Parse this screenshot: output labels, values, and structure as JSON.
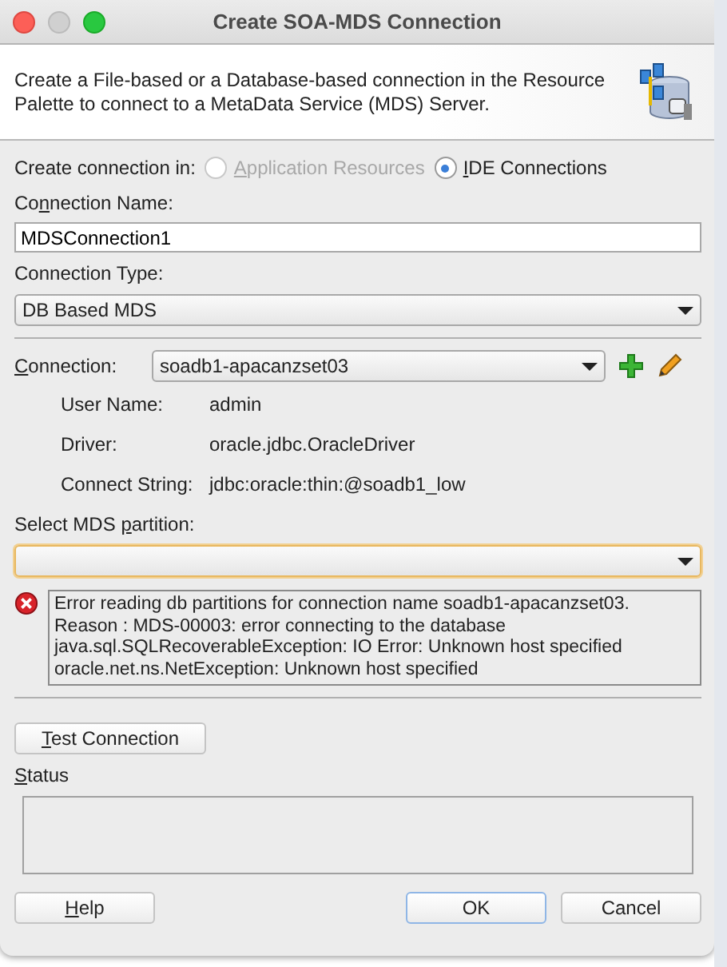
{
  "window": {
    "title": "Create SOA-MDS Connection"
  },
  "header": {
    "description": "Create a File-based or a Database-based connection in the Resource Palette to connect to a MetaData Service (MDS) Server."
  },
  "create_in": {
    "label": "Create connection in:",
    "options": [
      {
        "text": {
          "key": "A",
          "after": "pplication Resources"
        },
        "selected": false,
        "disabled": true
      },
      {
        "text": {
          "key": "I",
          "after": "DE Connections"
        },
        "selected": true,
        "disabled": false
      }
    ]
  },
  "connection_name": {
    "label": {
      "before": "Co",
      "key": "n",
      "after": "nection Name:"
    },
    "value": "MDSConnection1"
  },
  "connection_type": {
    "label": "Connection Type:",
    "value": "DB Based MDS"
  },
  "connection": {
    "label": {
      "key": "C",
      "after": "onnection:"
    },
    "value": "soadb1-apacanzset03",
    "details": [
      {
        "label": "User Name:",
        "value": "admin"
      },
      {
        "label": "Driver:",
        "value": "oracle.jdbc.OracleDriver"
      },
      {
        "label": "Connect String:",
        "value": "jdbc:oracle:thin:@soadb1_low"
      }
    ]
  },
  "mds_partition": {
    "label": {
      "before": "Select MDS ",
      "key": "p",
      "after": "artition:"
    }
  },
  "error": {
    "lines": [
      "Error reading db partitions for connection name soadb1-apacanzset03.",
      "Reason : MDS-00003: error connecting to the database",
      "java.sql.SQLRecoverableException: IO Error: Unknown host specified",
      "oracle.net.ns.NetException: Unknown host specified"
    ]
  },
  "test_button": {
    "text": {
      "key": "T",
      "after": "est Connection"
    }
  },
  "status": {
    "label": {
      "key": "S",
      "after": "tatus"
    }
  },
  "buttons": [
    {
      "text": {
        "key": "H",
        "after": "elp"
      },
      "default": false
    },
    {
      "text": {
        "before": "OK"
      },
      "default": true
    },
    {
      "text": {
        "before": "Cancel"
      },
      "default": false
    }
  ]
}
